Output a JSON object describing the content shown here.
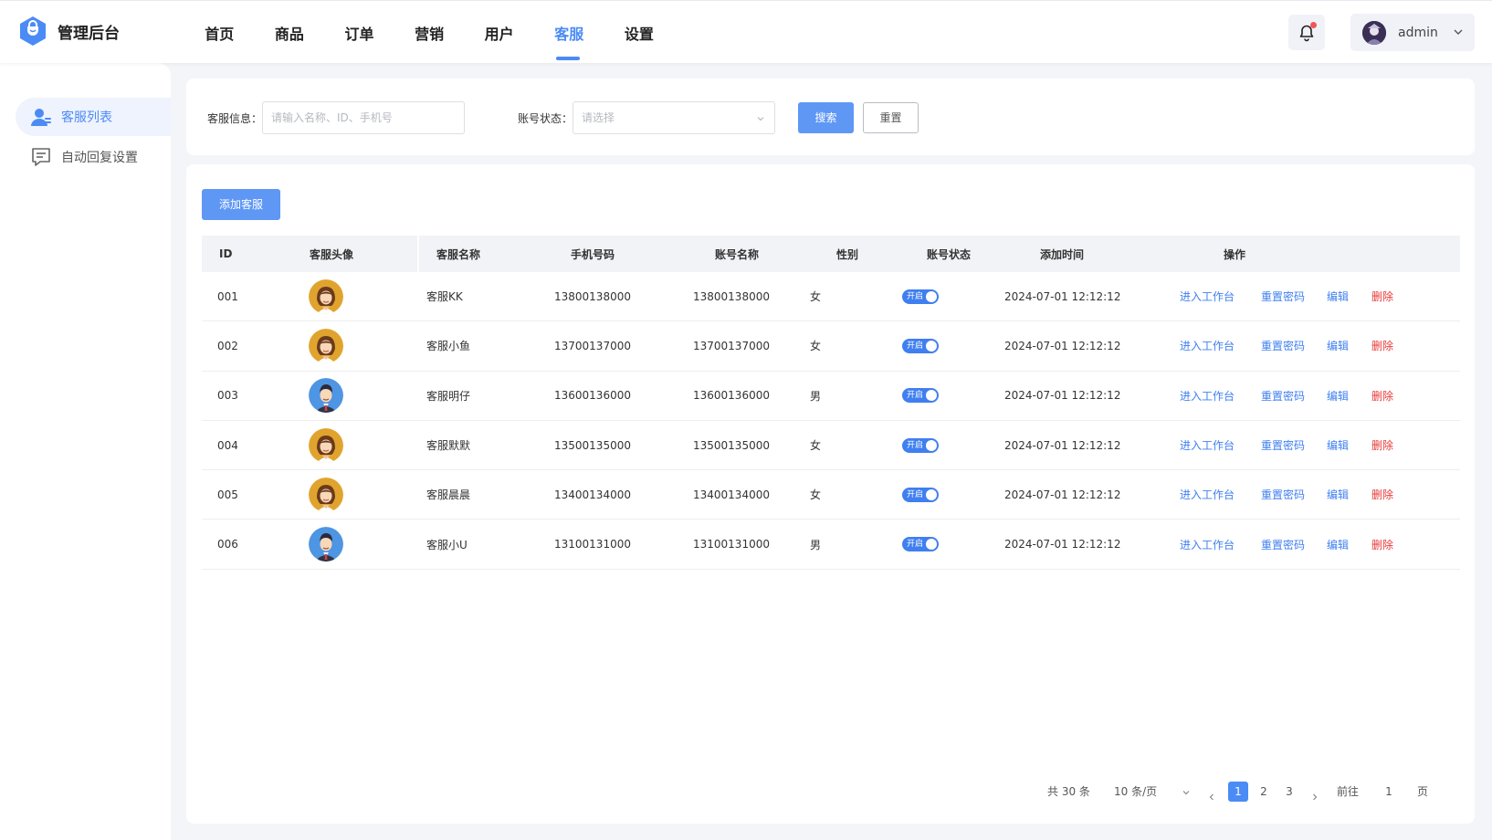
{
  "app": {
    "title": "管理后台"
  },
  "nav": [
    {
      "label": "首页",
      "active": false
    },
    {
      "label": "商品",
      "active": false
    },
    {
      "label": "订单",
      "active": false
    },
    {
      "label": "营销",
      "active": false
    },
    {
      "label": "用户",
      "active": false
    },
    {
      "label": "客服",
      "active": true
    },
    {
      "label": "设置",
      "active": false
    }
  ],
  "user": {
    "name": "admin",
    "has_notification": true
  },
  "sidebar": {
    "items": [
      {
        "label": "客服列表",
        "icon": "customer-service-user-icon",
        "active": true
      },
      {
        "label": "自动回复设置",
        "icon": "chat-message-icon",
        "active": false
      }
    ]
  },
  "search": {
    "info_label": "客服信息：",
    "info_placeholder": "请输入名称、ID、手机号",
    "status_label": "账号状态：",
    "status_placeholder": "请选择",
    "search_button": "搜索",
    "reset_button": "重置"
  },
  "toolbar": {
    "add_button": "添加客服"
  },
  "table": {
    "headers": {
      "id": "ID",
      "avatar": "客服头像",
      "name": "客服名称",
      "phone": "手机号码",
      "account": "账号名称",
      "gender": "性别",
      "status": "账号状态",
      "time": "添加时间",
      "ops": "操作"
    },
    "rows": [
      {
        "id": "001",
        "avatar": "female",
        "name": "客服KK",
        "phone": "13800138000",
        "account": "13800138000",
        "gender": "女",
        "status": "开启",
        "time": "2024-07-01 12:12:12"
      },
      {
        "id": "002",
        "avatar": "female",
        "name": "客服小鱼",
        "phone": "13700137000",
        "account": "13700137000",
        "gender": "女",
        "status": "开启",
        "time": "2024-07-01 12:12:12"
      },
      {
        "id": "003",
        "avatar": "male",
        "name": "客服明仔",
        "phone": "13600136000",
        "account": "13600136000",
        "gender": "男",
        "status": "开启",
        "time": "2024-07-01 12:12:12"
      },
      {
        "id": "004",
        "avatar": "female",
        "name": "客服默默",
        "phone": "13500135000",
        "account": "13500135000",
        "gender": "女",
        "status": "开启",
        "time": "2024-07-01 12:12:12"
      },
      {
        "id": "005",
        "avatar": "female",
        "name": "客服晨晨",
        "phone": "13400134000",
        "account": "13400134000",
        "gender": "女",
        "status": "开启",
        "time": "2024-07-01 12:12:12"
      },
      {
        "id": "006",
        "avatar": "male",
        "name": "客服小U",
        "phone": "13100131000",
        "account": "13100131000",
        "gender": "男",
        "status": "开启",
        "time": "2024-07-01 12:12:12"
      }
    ],
    "operations": {
      "workbench": "进入工作台",
      "reset_password": "重置密码",
      "edit": "编辑",
      "delete": "删除"
    }
  },
  "pagination": {
    "total": "共 30 条",
    "page_size": "10 条/页",
    "pages": [
      "1",
      "2",
      "3"
    ],
    "current_page": "1",
    "goto_prefix": "前往",
    "goto_value": "1",
    "goto_suffix": "页"
  },
  "colors": {
    "primary": "#4b8bf5",
    "danger": "#e83a3a",
    "background": "#f4f5f9"
  }
}
